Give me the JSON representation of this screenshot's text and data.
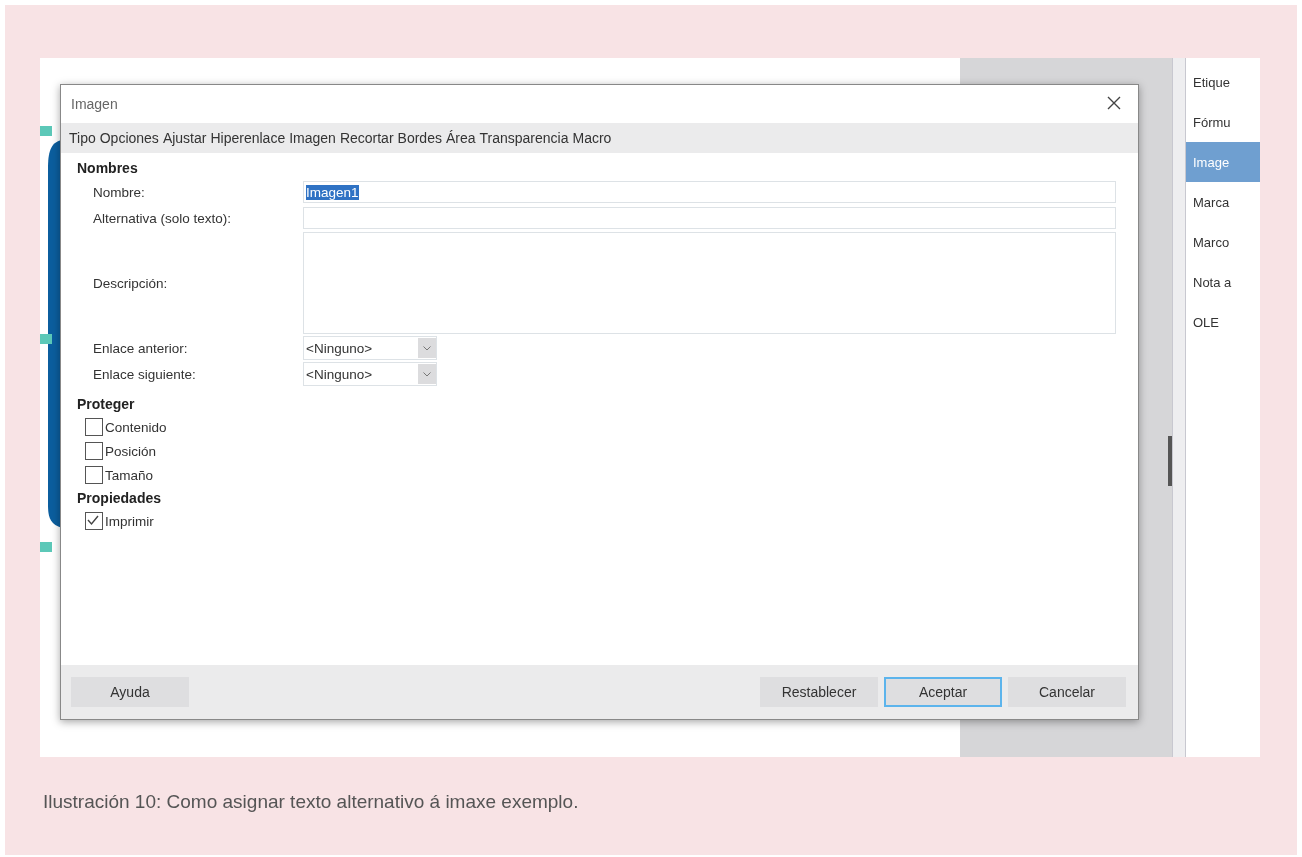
{
  "dialog": {
    "title": "Imagen",
    "tabs": [
      "Tipo",
      "Opciones",
      "Ajustar",
      "Hiperenlace",
      "Imagen",
      "Recortar",
      "Bordes",
      "Área",
      "Transparencia",
      "Macro"
    ],
    "names": {
      "heading": "Nombres",
      "fields": [
        {
          "kind": "text",
          "label": "Nombre:",
          "value": "Imagen1",
          "value_selected": true
        },
        {
          "kind": "text",
          "label": "Alternativa (solo texto):"
        },
        {
          "kind": "textarea",
          "label": "Descripción:"
        },
        {
          "kind": "dropdown",
          "label": "Enlace anterior:",
          "value": "<Ninguno>"
        },
        {
          "kind": "dropdown",
          "label": "Enlace siguiente:",
          "value": "<Ninguno>"
        }
      ]
    },
    "protect": {
      "heading": "Proteger",
      "options": [
        {
          "label": "Contenido",
          "checked": false
        },
        {
          "label": "Posición",
          "checked": false
        },
        {
          "label": "Tamaño",
          "checked": false
        }
      ]
    },
    "properties": {
      "heading": "Propiedades",
      "options": [
        {
          "label": "Imprimir",
          "checked": true
        }
      ]
    },
    "buttons": [
      {
        "label": "Ayuda",
        "kind": "left",
        "focused": false
      },
      {
        "label": "Restablecer",
        "kind": "right",
        "focused": false
      },
      {
        "label": "Aceptar",
        "kind": "right",
        "focused": true
      },
      {
        "label": "Cancelar",
        "kind": "right",
        "focused": false
      }
    ]
  },
  "side_panel": {
    "items": [
      {
        "label": "Etique",
        "selected": false
      },
      {
        "label": "Fórmu",
        "selected": false
      },
      {
        "label": "Image",
        "selected": true
      },
      {
        "label": "Marca",
        "selected": false
      },
      {
        "label": "Marco",
        "selected": false
      },
      {
        "label": "Nota a",
        "selected": false
      },
      {
        "label": "OLE",
        "selected": false
      }
    ]
  },
  "caption": "Ilustración 10: Como asignar texto alternativo á imaxe exemplo."
}
